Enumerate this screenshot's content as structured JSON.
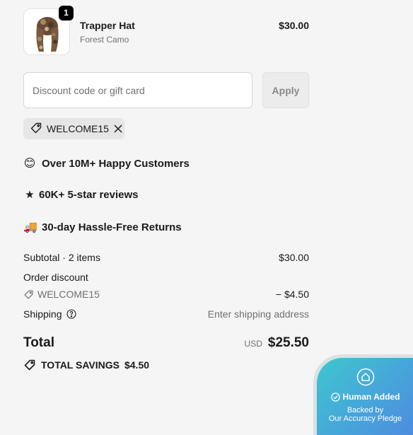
{
  "product": {
    "name": "Trapper Hat",
    "variant": "Forest Camo",
    "price": "$30.00",
    "quantity": "1",
    "image_icon": "trapper-hat-image"
  },
  "discount": {
    "placeholder": "Discount code or gift card",
    "value": "",
    "apply_label": "Apply",
    "applied_code": "WELCOME15"
  },
  "perks": [
    {
      "emoji": "😊",
      "text": "Over 10M+ Happy Customers"
    },
    {
      "emoji": "★",
      "text": "60K+ 5-star reviews"
    },
    {
      "emoji": "🚚",
      "text": "30-day Hassle-Free Returns"
    }
  ],
  "summary": {
    "subtotal_label": "Subtotal · 2 items",
    "subtotal_value": "$30.00",
    "order_discount_label": "Order discount",
    "discount_code": "WELCOME15",
    "discount_value": "− $4.50",
    "shipping_label": "Shipping",
    "shipping_value": "Enter shipping address",
    "total_label": "Total",
    "currency": "USD",
    "total_value": "$25.50",
    "savings_label": "TOTAL SAVINGS",
    "savings_value": "$4.50"
  },
  "badge": {
    "title": "Human Added",
    "subtitle_line1": "Backed by",
    "subtitle_line2": "Our Accuracy Pledge"
  },
  "colors": {
    "background": "#f5f5f5",
    "badge_gradient_start": "#3fc6cf",
    "badge_gradient_end": "#4f86df"
  }
}
